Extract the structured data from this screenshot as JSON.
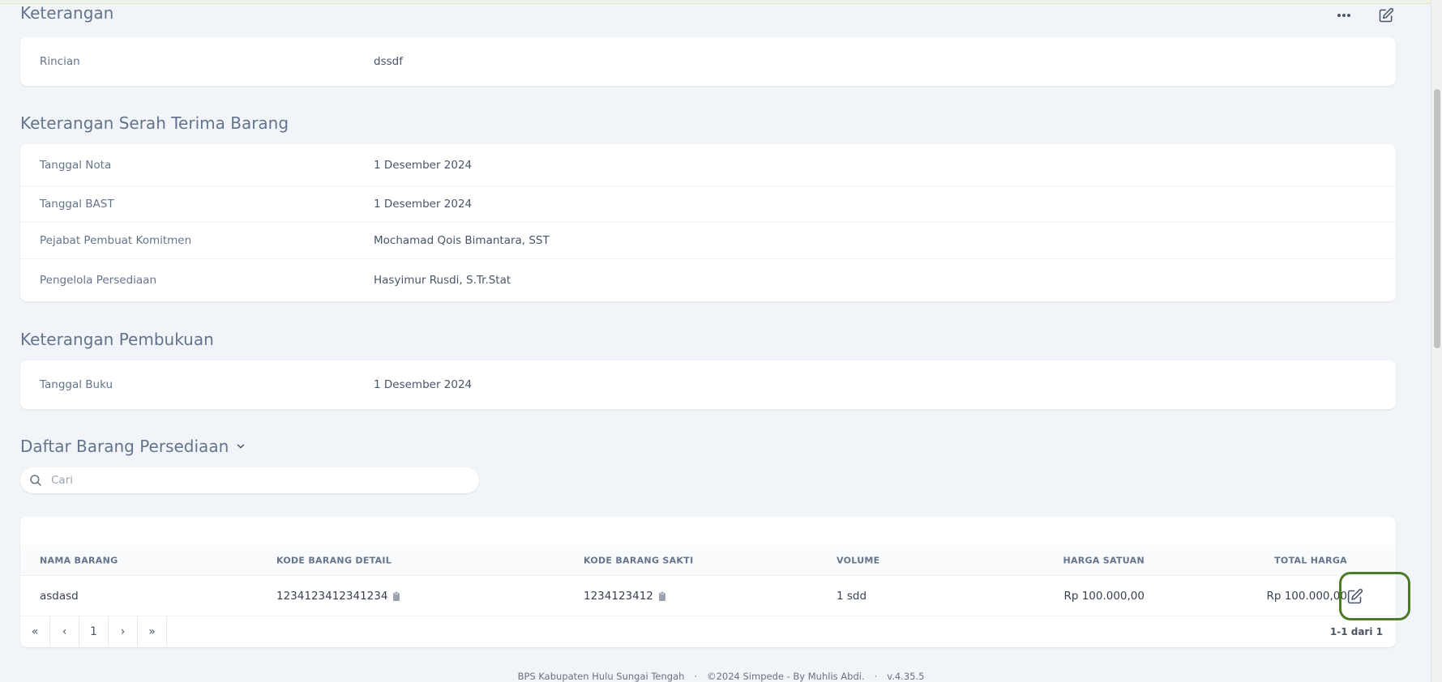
{
  "sections": {
    "keterangan": {
      "title": "Keterangan",
      "rows": [
        {
          "label": "Rincian",
          "value": "dssdf"
        }
      ]
    },
    "serah_terima": {
      "title": "Keterangan Serah Terima Barang",
      "rows": [
        {
          "label": "Tanggal Nota",
          "value": "1 Desember 2024"
        },
        {
          "label": "Tanggal BAST",
          "value": "1 Desember 2024"
        },
        {
          "label": "Pejabat Pembuat Komitmen",
          "value": "Mochamad Qois Bimantara, SST"
        },
        {
          "label": "Pengelola Persediaan",
          "value": "Hasyimur Rusdi, S.Tr.Stat"
        }
      ]
    },
    "pembukuan": {
      "title": "Keterangan Pembukuan",
      "rows": [
        {
          "label": "Tanggal Buku",
          "value": "1 Desember 2024"
        }
      ]
    }
  },
  "daftar": {
    "title": "Daftar Barang Persediaan",
    "search_placeholder": "Cari",
    "columns": [
      "NAMA BARANG",
      "KODE BARANG DETAIL",
      "KODE BARANG SAKTI",
      "VOLUME",
      "HARGA SATUAN",
      "TOTAL HARGA"
    ],
    "rows": [
      {
        "nama_barang": "asdasd",
        "kode_detail": "1234123412341234",
        "kode_sakti": "1234123412",
        "volume": "1 sdd",
        "harga_satuan": "Rp 100.000,00",
        "total_harga": "Rp 100.000,00"
      }
    ],
    "pagination": {
      "first": "«",
      "prev": "‹",
      "page": "1",
      "next": "›",
      "last": "»",
      "info": "1-1 dari 1"
    }
  },
  "footer": {
    "org": "BPS Kabupaten Hulu Sungai Tengah",
    "sep": "·",
    "copyright": "©2024 Simpede - By Muhlis Abdi.",
    "version": "v.4.35.5"
  },
  "icons": {
    "more": "more-horizontal-icon",
    "edit": "pencil-square-icon",
    "search": "magnifier-icon",
    "copy": "clipboard-icon",
    "chevron": "chevron-down-icon"
  },
  "colors": {
    "background": "#f1f4f8",
    "card": "#ffffff",
    "highlight_ring": "#4e7a27",
    "title": "#64748b"
  }
}
